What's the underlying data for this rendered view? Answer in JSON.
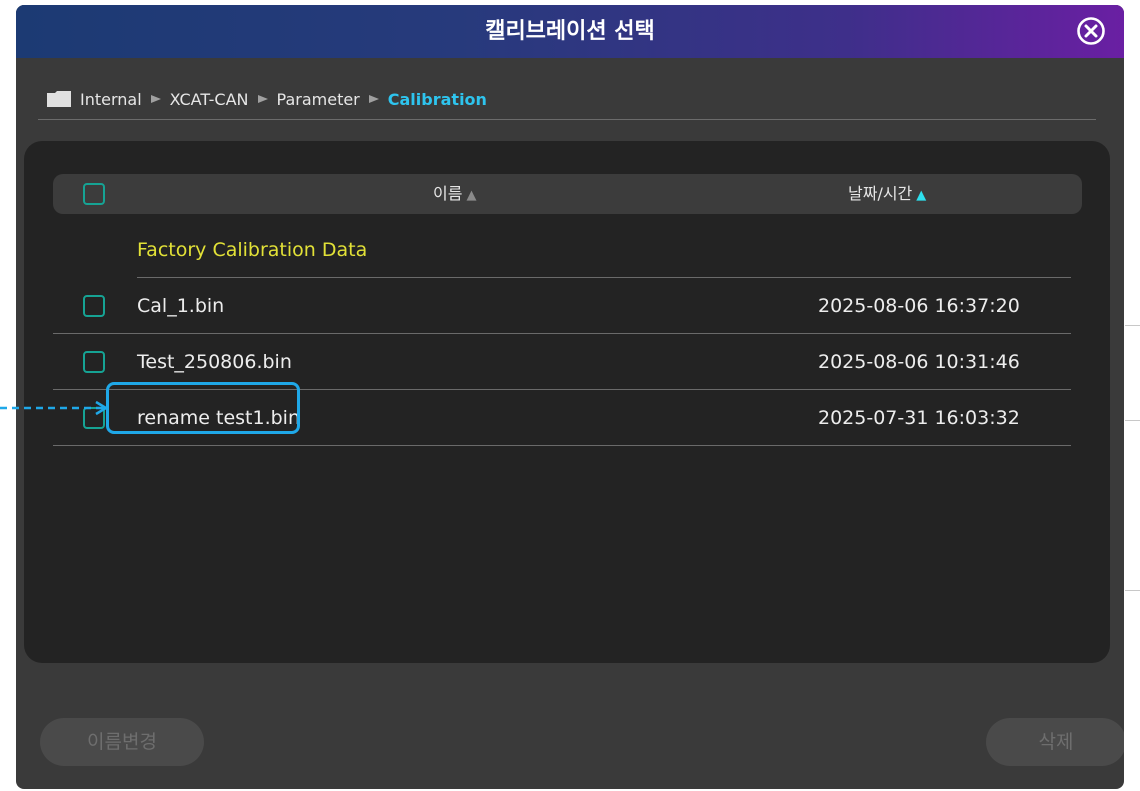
{
  "title": "캘리브레이션 선택",
  "close_icon": "close-circle-icon",
  "breadcrumb": {
    "folder_icon": "folder-icon",
    "separator_icon": "arrow-right-icon",
    "items": [
      "Internal",
      "XCAT-CAN",
      "Parameter",
      "Calibration"
    ]
  },
  "table": {
    "col_name": "이름",
    "col_date": "날짜/시간",
    "sort_name_icon": "▲",
    "sort_date_icon": "▲",
    "group_label": "Factory Calibration Data",
    "rows": [
      {
        "name": "Cal_1.bin",
        "date": "2025-08-06 16:37:20",
        "checked": false
      },
      {
        "name": "Test_250806.bin",
        "date": "2025-08-06 10:31:46",
        "checked": false
      },
      {
        "name": "rename test1.bin",
        "date": "2025-07-31 16:03:32",
        "checked": false,
        "highlighted": true
      }
    ]
  },
  "buttons": {
    "rename": "이름변경",
    "delete": "삭제"
  },
  "colors": {
    "title_gradient_start": "#1c3a73",
    "title_gradient_end": "#6a1fa3",
    "active_crumb": "#2ec4ee",
    "group_label": "#e2e137",
    "checkbox": "#16a394",
    "highlight": "#1fa8e8"
  }
}
